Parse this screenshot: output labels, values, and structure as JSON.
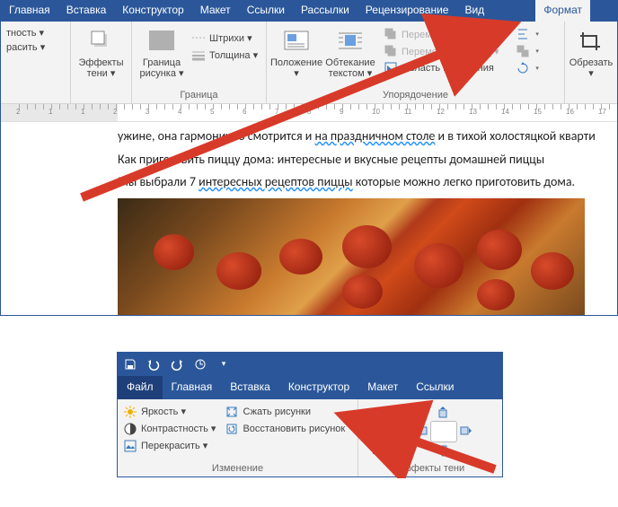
{
  "top": {
    "tabs": [
      "Главная",
      "Вставка",
      "Конструктор",
      "Макет",
      "Ссылки",
      "Рассылки",
      "Рецензирование",
      "Вид"
    ],
    "format_tab": "Формат",
    "groups": {
      "adjust": {
        "brightness_partial": "тность ▾",
        "recolor_partial": "расить ▾",
        "effects": "Эффекты\nтени ▾"
      },
      "border": {
        "border_btn": "Граница\nрисунка ▾",
        "hatch": "Штрихи ▾",
        "weight": "Толщина ▾",
        "label": "Граница"
      },
      "arrange": {
        "position": "Положение\n▾",
        "wrap": "Обтекание\nтекстом ▾",
        "forward": "Переместить вперед ▾",
        "backward": "Переместить назад ▾",
        "selection": "Область выделения",
        "label": "Упорядочение"
      },
      "crop": {
        "crop": "Обрезать\n▾"
      }
    }
  },
  "doc": {
    "line1a": "ужине, она гармонично смотрится и ",
    "line1b": "на праздничном столе",
    "line1c": " и в тихой холостяцкой кварти",
    "line2": "Как приготовить пиццу дома: интересные и вкусные рецепты домашней пиццы",
    "line3a": "Мы выбрали 7 ",
    "line3b": "интересных рецептов пиццы",
    "line3c": " которые можно легко приготовить дома."
  },
  "bottom": {
    "tabs": [
      "Файл",
      "Главная",
      "Вставка",
      "Конструктор",
      "Макет",
      "Ссылки"
    ],
    "change": {
      "brightness": "Яркость ▾",
      "contrast": "Контрастность ▾",
      "recolor": "Перекрасить ▾",
      "compress": "Сжать рисунки",
      "reset": "Восстановить рисунок",
      "label": "Изменение"
    },
    "shadow": {
      "effects": "Эффекты\nтени ▾",
      "label": "Эффекты тени"
    }
  },
  "ruler_nums": [
    2,
    1,
    1,
    2,
    3,
    4,
    5,
    6,
    7,
    8,
    9,
    10,
    11,
    12,
    13,
    14,
    15,
    16,
    17
  ]
}
